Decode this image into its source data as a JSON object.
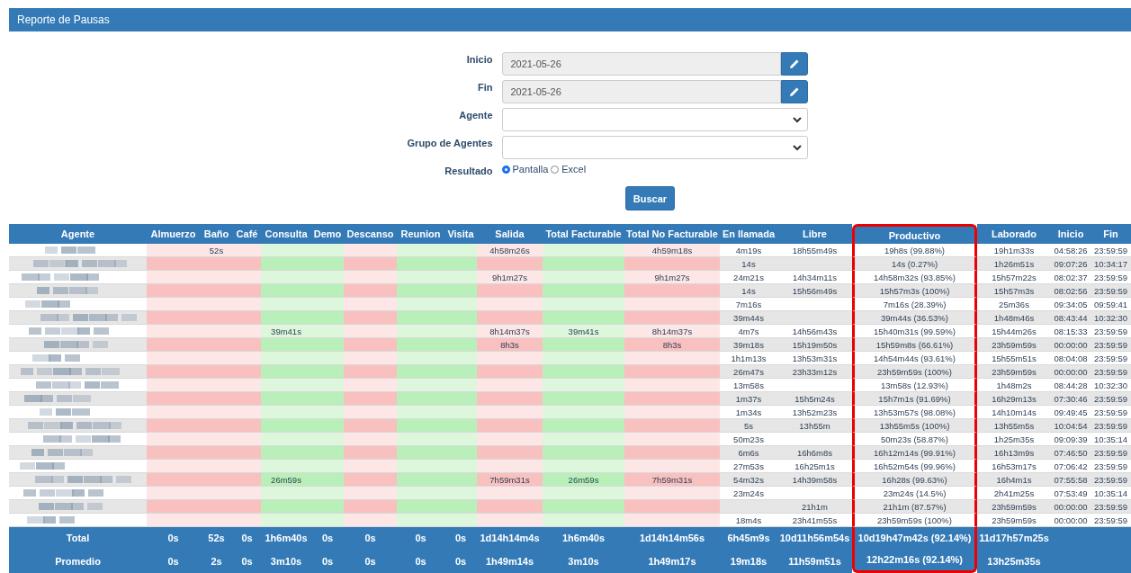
{
  "panel": {
    "title": "Reporte de Pausas"
  },
  "form": {
    "fields": [
      {
        "kind": "date",
        "label": "Inicio",
        "value": "2021-05-26"
      },
      {
        "kind": "date",
        "label": "Fin",
        "value": "2021-05-26"
      },
      {
        "kind": "select",
        "label": "Agente"
      },
      {
        "kind": "select",
        "label": "Grupo de Agentes"
      },
      {
        "kind": "radio",
        "label": "Resultado",
        "options": [
          {
            "label": "Pantalla",
            "selected": true
          },
          {
            "label": "Excel",
            "selected": false
          }
        ]
      }
    ],
    "submit": "Buscar"
  },
  "table": {
    "columns": [
      {
        "label": "Agente",
        "kind": "agent",
        "highlighted": false
      },
      {
        "label": "Almuerzo",
        "kind": "nonbillable",
        "highlighted": false
      },
      {
        "label": "Baño",
        "kind": "nonbillable",
        "highlighted": false
      },
      {
        "label": "Café",
        "kind": "nonbillable",
        "highlighted": false
      },
      {
        "label": "Consulta",
        "kind": "billable",
        "highlighted": false
      },
      {
        "label": "Demo",
        "kind": "billable",
        "highlighted": false
      },
      {
        "label": "Descanso",
        "kind": "nonbillable",
        "highlighted": false
      },
      {
        "label": "Reunion",
        "kind": "billable",
        "highlighted": false
      },
      {
        "label": "Visita",
        "kind": "billable",
        "highlighted": false
      },
      {
        "label": "Salida",
        "kind": "nonbillable",
        "highlighted": false
      },
      {
        "label": "Total Facturable",
        "kind": "billable",
        "highlighted": false
      },
      {
        "label": "Total No Facturable",
        "kind": "nonbillable",
        "highlighted": false
      },
      {
        "label": "En llamada",
        "kind": "info",
        "highlighted": false
      },
      {
        "label": "Libre",
        "kind": "info",
        "highlighted": false
      },
      {
        "label": "Productivo",
        "kind": "info",
        "highlighted": true
      },
      {
        "label": "Laborado",
        "kind": "info",
        "highlighted": false
      },
      {
        "label": "Inicio",
        "kind": "info",
        "highlighted": false
      },
      {
        "label": "Fin",
        "kind": "info",
        "highlighted": false
      }
    ],
    "rows": [
      [
        "",
        "",
        "52s",
        "",
        "",
        "",
        "",
        "",
        "",
        "4h58m26s",
        "",
        "4h59m18s",
        "4m19s",
        "18h55m49s",
        "19h8s (99.88%)",
        "19h1m33s",
        "04:58:26",
        "23:59:59"
      ],
      [
        "",
        "",
        "",
        "",
        "",
        "",
        "",
        "",
        "",
        "",
        "",
        "",
        "14s",
        "",
        "14s (0.27%)",
        "1h26m51s",
        "09:07:26",
        "10:34:17"
      ],
      [
        "",
        "",
        "",
        "",
        "",
        "",
        "",
        "",
        "",
        "9h1m27s",
        "",
        "9h1m27s",
        "24m21s",
        "14h34m11s",
        "14h58m32s (93.85%)",
        "15h57m22s",
        "08:02:37",
        "23:59:59"
      ],
      [
        "",
        "",
        "",
        "",
        "",
        "",
        "",
        "",
        "",
        "",
        "",
        "",
        "14s",
        "15h56m49s",
        "15h57m3s (100%)",
        "15h57m3s",
        "08:02:56",
        "23:59:59"
      ],
      [
        "",
        "",
        "",
        "",
        "",
        "",
        "",
        "",
        "",
        "",
        "",
        "",
        "7m16s",
        "",
        "7m16s (28.39%)",
        "25m36s",
        "09:34:05",
        "09:59:41"
      ],
      [
        "",
        "",
        "",
        "",
        "",
        "",
        "",
        "",
        "",
        "",
        "",
        "",
        "39m44s",
        "",
        "39m44s (36.53%)",
        "1h48m46s",
        "08:43:44",
        "10:32:30"
      ],
      [
        "",
        "",
        "",
        "",
        "39m41s",
        "",
        "",
        "",
        "",
        "8h14m37s",
        "39m41s",
        "8h14m37s",
        "4m7s",
        "14h56m43s",
        "15h40m31s (99.59%)",
        "15h44m26s",
        "08:15:33",
        "23:59:59"
      ],
      [
        "",
        "",
        "",
        "",
        "",
        "",
        "",
        "",
        "",
        "8h3s",
        "",
        "8h3s",
        "39m18s",
        "15h19m50s",
        "15h59m8s (66.61%)",
        "23h59m59s",
        "00:00:00",
        "23:59:59"
      ],
      [
        "",
        "",
        "",
        "",
        "",
        "",
        "",
        "",
        "",
        "",
        "",
        "",
        "1h1m13s",
        "13h53m31s",
        "14h54m44s (93.61%)",
        "15h55m51s",
        "08:04:08",
        "23:59:59"
      ],
      [
        "",
        "",
        "",
        "",
        "",
        "",
        "",
        "",
        "",
        "",
        "",
        "",
        "26m47s",
        "23h33m12s",
        "23h59m59s (100%)",
        "23h59m59s",
        "00:00:00",
        "23:59:59"
      ],
      [
        "",
        "",
        "",
        "",
        "",
        "",
        "",
        "",
        "",
        "",
        "",
        "",
        "13m58s",
        "",
        "13m58s (12.93%)",
        "1h48m2s",
        "08:44:28",
        "10:32:30"
      ],
      [
        "",
        "",
        "",
        "",
        "",
        "",
        "",
        "",
        "",
        "",
        "",
        "",
        "1m37s",
        "15h5m24s",
        "15h7m1s (91.69%)",
        "16h29m13s",
        "07:30:46",
        "23:59:59"
      ],
      [
        "",
        "",
        "",
        "",
        "",
        "",
        "",
        "",
        "",
        "",
        "",
        "",
        "1m34s",
        "13h52m23s",
        "13h53m57s (98.08%)",
        "14h10m14s",
        "09:49:45",
        "23:59:59"
      ],
      [
        "",
        "",
        "",
        "",
        "",
        "",
        "",
        "",
        "",
        "",
        "",
        "",
        "5s",
        "13h55m",
        "13h55m5s (100%)",
        "13h55m5s",
        "10:04:54",
        "23:59:59"
      ],
      [
        "",
        "",
        "",
        "",
        "",
        "",
        "",
        "",
        "",
        "",
        "",
        "",
        "50m23s",
        "",
        "50m23s (58.87%)",
        "1h25m35s",
        "09:09:39",
        "10:35:14"
      ],
      [
        "",
        "",
        "",
        "",
        "",
        "",
        "",
        "",
        "",
        "",
        "",
        "",
        "6m6s",
        "16h6m8s",
        "16h12m14s (99.91%)",
        "16h13m9s",
        "07:46:50",
        "23:59:59"
      ],
      [
        "",
        "",
        "",
        "",
        "",
        "",
        "",
        "",
        "",
        "",
        "",
        "",
        "27m53s",
        "16h25m1s",
        "16h52m54s (99.96%)",
        "16h53m17s",
        "07:06:42",
        "23:59:59"
      ],
      [
        "",
        "",
        "",
        "",
        "26m59s",
        "",
        "",
        "",
        "",
        "7h59m31s",
        "26m59s",
        "7h59m31s",
        "54m32s",
        "14h39m58s",
        "16h28s (99.63%)",
        "16h4m1s",
        "07:55:58",
        "23:59:59"
      ],
      [
        "",
        "",
        "",
        "",
        "",
        "",
        "",
        "",
        "",
        "",
        "",
        "",
        "23m24s",
        "",
        "23m24s (14.5%)",
        "2h41m25s",
        "07:53:49",
        "10:35:14"
      ],
      [
        "",
        "",
        "",
        "",
        "",
        "",
        "",
        "",
        "",
        "",
        "",
        "",
        "",
        "21h1m",
        "21h1m (87.57%)",
        "23h59m59s",
        "00:00:00",
        "23:59:59"
      ],
      [
        "",
        "",
        "",
        "",
        "",
        "",
        "",
        "",
        "",
        "",
        "",
        "",
        "18m4s",
        "23h41m55s",
        "23h59m59s (100%)",
        "23h59m59s",
        "00:00:00",
        "23:59:59"
      ]
    ],
    "footer": [
      [
        "Total",
        "0s",
        "52s",
        "0s",
        "1h6m40s",
        "0s",
        "0s",
        "0s",
        "0s",
        "1d14h14m4s",
        "1h6m40s",
        "1d14h14m56s",
        "6h45m9s",
        "10d11h56m54s",
        "10d19h47m42s (92.14%)",
        "11d17h57m25s"
      ],
      [
        "Promedio",
        "0s",
        "2s",
        "0s",
        "3m10s",
        "0s",
        "0s",
        "0s",
        "0s",
        "1h49m14s",
        "3m10s",
        "1h49m17s",
        "19m18s",
        "11h59m51s",
        "12h22m16s (92.14%)",
        "13h25m35s"
      ]
    ]
  }
}
